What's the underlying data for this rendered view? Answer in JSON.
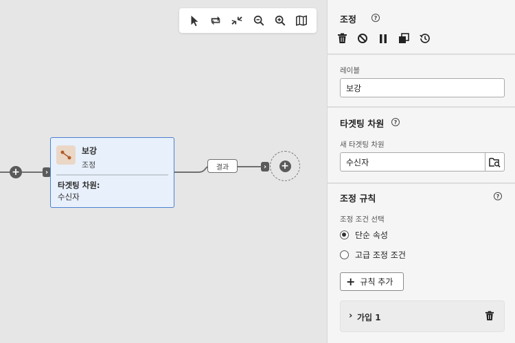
{
  "canvas": {
    "toolbar": [
      "pointer-icon",
      "swap-icon",
      "collapse-icon",
      "zoom-out-icon",
      "zoom-in-icon",
      "map-icon"
    ],
    "node": {
      "title": "보강",
      "subtitle": "조정",
      "attribute_label": "타겟팅 차원:",
      "attribute_value": "수신자"
    },
    "result_label": "결과"
  },
  "panel": {
    "title": "조정",
    "actions": [
      "delete-icon",
      "disable-icon",
      "pause-icon",
      "copy-icon",
      "history-icon"
    ],
    "label_field": {
      "label": "레이블",
      "value": "보강"
    },
    "targeting": {
      "title": "타겟팅 차원",
      "new_label": "새 타겟팅 차원",
      "value": "수신자"
    },
    "rules": {
      "title": "조정 규칙",
      "selection_label": "조정 조건 선택",
      "options": [
        {
          "label": "단순 속성",
          "selected": true
        },
        {
          "label": "고급 조정 조건",
          "selected": false
        }
      ],
      "add_rule_label": "규칙 추가",
      "join_label": "가입 1"
    }
  },
  "colors": {
    "accent_border": "#4a7fd0",
    "node_bg": "#e8f0fb",
    "icon_bg": "#ead7c6"
  }
}
